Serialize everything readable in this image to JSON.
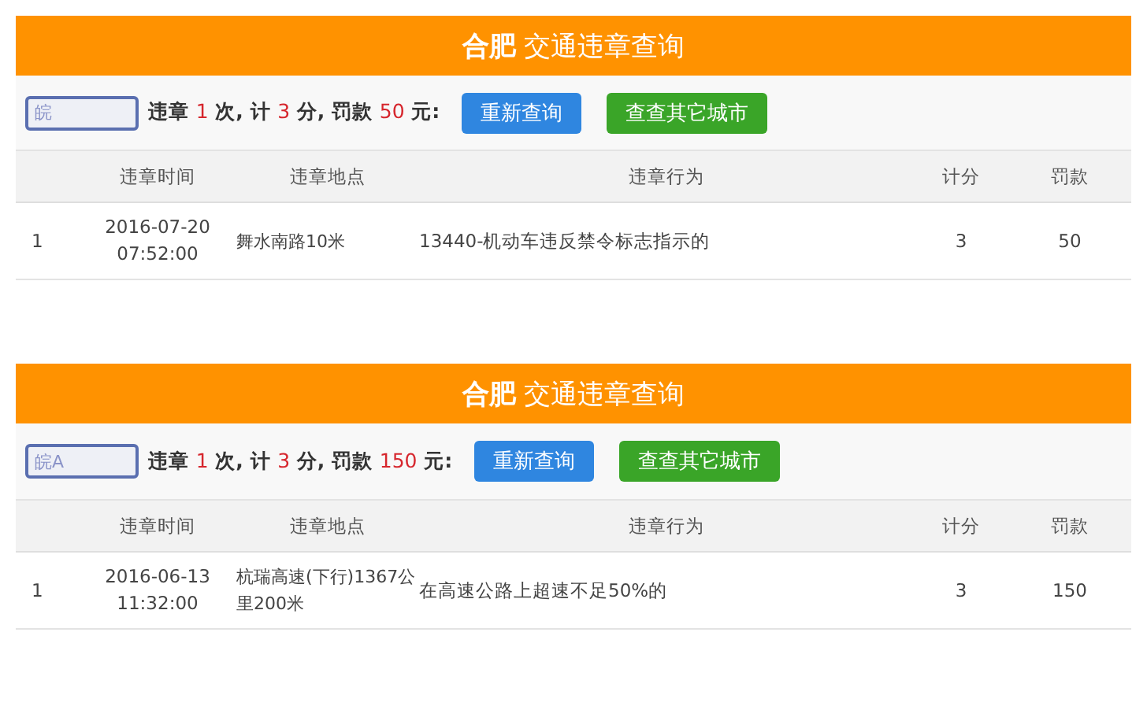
{
  "panels": [
    {
      "title": "**合肥** 交通违章查询",
      "plate": {
        "value": "皖"
      },
      "summary": [
        {
          "text": "违章 ",
          "highlight": false
        },
        {
          "text": "1",
          "highlight": true
        },
        {
          "text": " 次, 计 ",
          "highlight": false
        },
        {
          "text": "3",
          "highlight": true
        },
        {
          "text": " 分, 罚款 ",
          "highlight": false
        },
        {
          "text": "50",
          "highlight": true
        },
        {
          "text": " 元:",
          "highlight": false
        }
      ],
      "buttons": [
        {
          "label": "重新查询",
          "kind": "primary"
        },
        {
          "label": "查查其它城市",
          "kind": "success"
        }
      ],
      "columns": [
        "违章时间",
        "违章地点",
        "违章行为",
        "计分",
        "罚款"
      ],
      "rows": [
        {
          "index": "1",
          "time": [
            "2016-07-20",
            "07:52:00"
          ],
          "location": "舞水南路10米",
          "behavior": "13440-机动车违反禁令标志指示的",
          "points": "3",
          "fine": "50"
        }
      ]
    },
    {
      "title": "**合肥** 交通违章查询",
      "plate": {
        "value": "皖A"
      },
      "summary": [
        {
          "text": "违章 ",
          "highlight": false
        },
        {
          "text": "1",
          "highlight": true
        },
        {
          "text": " 次, 计 ",
          "highlight": false
        },
        {
          "text": "3",
          "highlight": true
        },
        {
          "text": " 分, 罚款 ",
          "highlight": false
        },
        {
          "text": "150",
          "highlight": true
        },
        {
          "text": " 元:",
          "highlight": false
        }
      ],
      "buttons": [
        {
          "label": "重新查询",
          "kind": "primary"
        },
        {
          "label": "查查其它城市",
          "kind": "success"
        }
      ],
      "columns": [
        "违章时间",
        "违章地点",
        "违章行为",
        "计分",
        "罚款"
      ],
      "rows": [
        {
          "index": "1",
          "time": [
            "2016-06-13",
            "11:32:00"
          ],
          "location": "杭瑞高速(下行)1367公里200米",
          "behavior": "在高速公路上超速不足50%的",
          "points": "3",
          "fine": "150"
        }
      ]
    }
  ]
}
